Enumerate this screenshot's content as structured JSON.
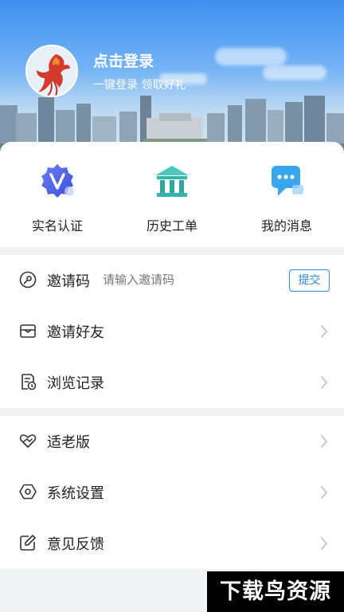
{
  "header": {
    "login_title": "点击登录",
    "login_subtitle": "一键登录 领取好礼"
  },
  "quick_actions": [
    {
      "label": "实名认证",
      "icon": "verified-badge-icon"
    },
    {
      "label": "历史工单",
      "icon": "bank-building-icon"
    },
    {
      "label": "我的消息",
      "icon": "chat-bubble-icon"
    }
  ],
  "invite": {
    "label": "邀请码",
    "placeholder": "请输入邀请码",
    "submit_label": "提交"
  },
  "menu_group1": [
    {
      "label": "邀请好友",
      "icon": "invite-envelope-icon"
    },
    {
      "label": "浏览记录",
      "icon": "history-doc-icon"
    }
  ],
  "menu_group2": [
    {
      "label": "适老版",
      "icon": "heart-hands-icon"
    },
    {
      "label": "系统设置",
      "icon": "settings-hexagon-icon"
    },
    {
      "label": "意见反馈",
      "icon": "feedback-edit-icon"
    }
  ],
  "watermark": "下载鸟资源",
  "colors": {
    "accent": "#2b8ee0",
    "header_top": "#3f8ff0",
    "background": "#f2f3f5"
  }
}
